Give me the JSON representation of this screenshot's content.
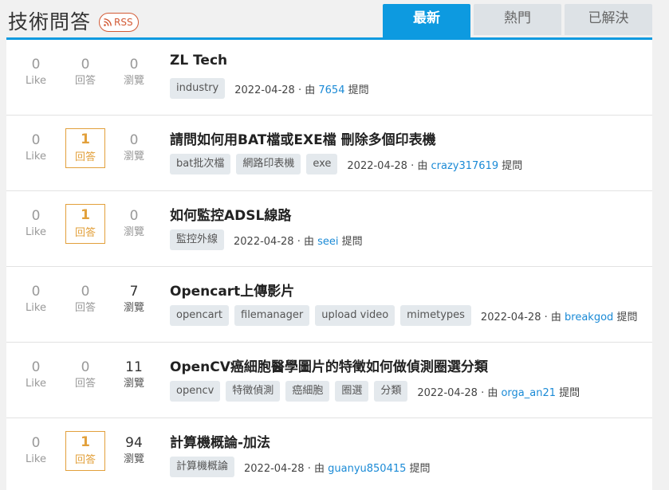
{
  "header": {
    "title": "技術問答",
    "rss_label": "RSS",
    "tabs": [
      {
        "label": "最新",
        "active": true
      },
      {
        "label": "熱門",
        "active": false
      },
      {
        "label": "已解決",
        "active": false
      }
    ]
  },
  "labels": {
    "like": "Like",
    "answer": "回答",
    "view": "瀏覽",
    "by": "· 由",
    "asked": "提問"
  },
  "questions": [
    {
      "title": "ZL Tech",
      "likes": "0",
      "answers": "0",
      "views": "0",
      "tags": [
        "industry"
      ],
      "date": "2022-04-28",
      "user": "7654"
    },
    {
      "title": "請問如何用BAT檔或EXE檔 刪除多個印表機",
      "likes": "0",
      "answers": "1",
      "views": "0",
      "tags": [
        "bat批次檔",
        "網路印表機",
        "exe"
      ],
      "date": "2022-04-28",
      "user": "crazy317619"
    },
    {
      "title": "如何監控ADSL線路",
      "likes": "0",
      "answers": "1",
      "views": "0",
      "tags": [
        "監控外線"
      ],
      "date": "2022-04-28",
      "user": "seei"
    },
    {
      "title": "Opencart上傳影片",
      "likes": "0",
      "answers": "0",
      "views": "7",
      "tags": [
        "opencart",
        "filemanager",
        "upload video",
        "mimetypes"
      ],
      "date": "2022-04-28",
      "user": "breakgod"
    },
    {
      "title": "OpenCV癌細胞醫學圖片的特徵如何做偵測圈選分類",
      "likes": "0",
      "answers": "0",
      "views": "11",
      "tags": [
        "opencv",
        "特徵偵測",
        "癌細胞",
        "圈選",
        "分類"
      ],
      "date": "2022-04-28",
      "user": "orga_an21"
    },
    {
      "title": "計算機概論-加法",
      "likes": "0",
      "answers": "1",
      "views": "94",
      "tags": [
        "計算機概論"
      ],
      "date": "2022-04-28",
      "user": "guanyu850415"
    }
  ],
  "colors": {
    "accent": "#0d9ae0",
    "answered": "#e2a03b",
    "rss": "#d35a35",
    "user_link": "#1a8ad6"
  }
}
